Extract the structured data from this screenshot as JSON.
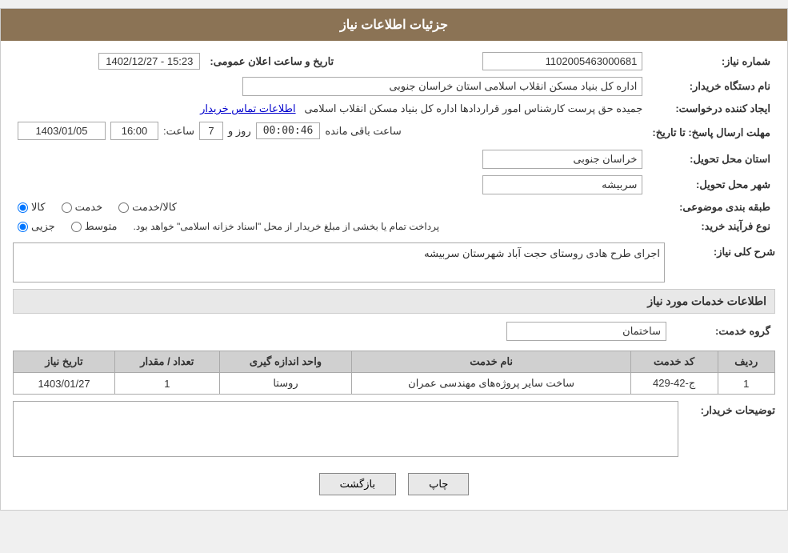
{
  "header": {
    "title": "جزئیات اطلاعات نیاز"
  },
  "fields": {
    "need_number_label": "شماره نیاز:",
    "need_number_value": "1102005463000681",
    "announcement_label": "تاریخ و ساعت اعلان عمومی:",
    "announcement_value": "1402/12/27 - 15:23",
    "buyer_org_label": "نام دستگاه خریدار:",
    "buyer_org_value": "اداره کل بنیاد مسکن انقلاب اسلامی استان خراسان جنوبی",
    "requester_label": "ایجاد کننده درخواست:",
    "requester_value": "جمیده حق پرست کارشناس امور قراردادها اداره کل بنیاد مسکن انقلاب اسلامی",
    "contact_link": "اطلاعات تماس خریدار",
    "deadline_label": "مهلت ارسال پاسخ: تا تاریخ:",
    "deadline_date": "1403/01/05",
    "deadline_time_label": "ساعت:",
    "deadline_time": "16:00",
    "deadline_days_label": "روز و",
    "deadline_days": "7",
    "deadline_remaining_label": "ساعت باقی مانده",
    "deadline_remaining": "00:00:46",
    "province_label": "استان محل تحویل:",
    "province_value": "خراسان جنوبی",
    "city_label": "شهر محل تحویل:",
    "city_value": "سربیشه",
    "category_label": "طبقه بندی موضوعی:",
    "category_kala": "کالا",
    "category_khedmat": "خدمت",
    "category_kala_khedmat": "کالا/خدمت",
    "process_label": "نوع فرآیند خرید:",
    "process_jazee": "جزیی",
    "process_motavaset": "متوسط",
    "process_desc": "پرداخت تمام یا بخشی از مبلغ خریدار از محل \"اسناد خزانه اسلامی\" خواهد بود.",
    "need_desc_label": "شرح کلی نیاز:",
    "need_desc_value": "اجرای طرح هادی روستای حجت آباد شهرستان سربیشه",
    "services_label": "اطلاعات خدمات مورد نیاز",
    "service_group_label": "گروه خدمت:",
    "service_group_value": "ساختمان",
    "table": {
      "columns": [
        "ردیف",
        "کد خدمت",
        "نام خدمت",
        "واحد اندازه گیری",
        "تعداد / مقدار",
        "تاریخ نیاز"
      ],
      "rows": [
        {
          "row": "1",
          "code": "ج-42-429",
          "name": "ساخت سایر پروژه‌های مهندسی عمران",
          "unit": "روستا",
          "quantity": "1",
          "date": "1403/01/27"
        }
      ]
    },
    "buyer_notes_label": "توضیحات خریدار:",
    "buyer_notes_value": ""
  },
  "buttons": {
    "print_label": "چاپ",
    "back_label": "بازگشت"
  }
}
